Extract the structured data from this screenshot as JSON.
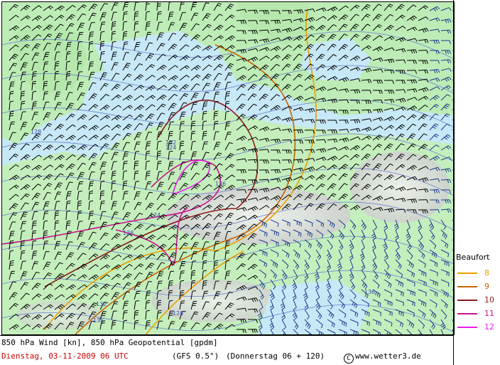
{
  "footer": {
    "line1": "850 hPa Wind [kn], 850 hPa Geopotential [gpdm]",
    "date": "Dienstag, 03-11-2009  06 UTC",
    "model": "(GFS 0.5°)",
    "valid": "(Donnerstag 06 + 120)",
    "copyright_symbol": "C",
    "source": "www.wetter3.de"
  },
  "legend": {
    "title": "Beaufort",
    "items": [
      {
        "label": "8",
        "color": "#e8a000"
      },
      {
        "label": "9",
        "color": "#c86400"
      },
      {
        "label": "10",
        "color": "#8b1a1a"
      },
      {
        "label": "11",
        "color": "#c8148c"
      },
      {
        "label": "12",
        "color": "#e61ee6"
      }
    ]
  },
  "map": {
    "geopotential_labels": [
      "124",
      "128",
      "132",
      "136",
      "136",
      "128",
      "132",
      "124",
      "128",
      "136"
    ],
    "colors": {
      "sea": "#bfe6f5",
      "land_low": "#b8ebb0",
      "land_high": "#e6e6e6",
      "barb_north": "#000000",
      "barb_south": "#1a3a8a",
      "isoline": "#6a7fd0"
    }
  }
}
